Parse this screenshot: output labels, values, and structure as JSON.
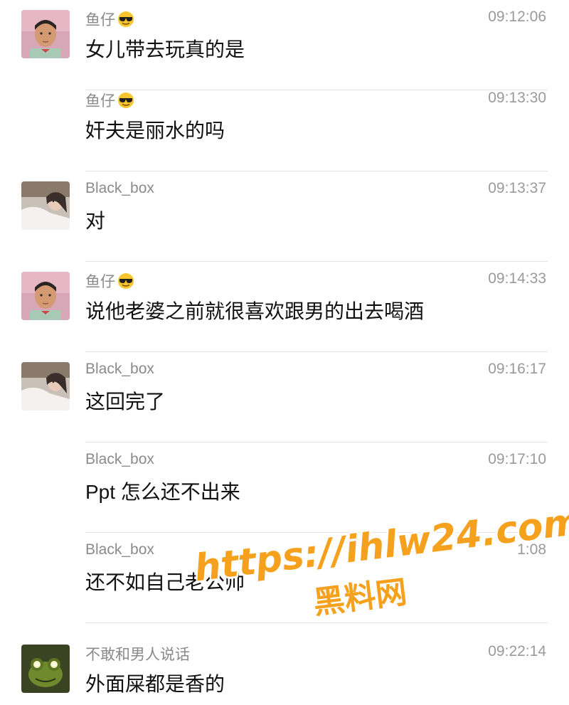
{
  "messages": [
    {
      "sender": "鱼仔",
      "time": "09:12:06",
      "text": "女儿带去玩真的是"
    },
    {
      "sender": "鱼仔",
      "time": "09:13:30",
      "text": "奸夫是丽水的吗"
    },
    {
      "sender": "Black_box",
      "time": "09:13:37",
      "text": "对"
    },
    {
      "sender": "鱼仔",
      "time": "09:14:33",
      "text": "说他老婆之前就很喜欢跟男的出去喝酒"
    },
    {
      "sender": "Black_box",
      "time": "09:16:17",
      "text": "这回完了"
    },
    {
      "sender": "Black_box",
      "time": "09:17:10",
      "text": "Ppt 怎么还不出来"
    },
    {
      "sender": "Black_box",
      "time": "1:08",
      "text": "还不如自己老公帅"
    },
    {
      "sender": "不敢和男人说话",
      "time": "09:22:14",
      "text": "外面屎都是香的"
    }
  ],
  "watermark": {
    "url": "https://ihlw24.com",
    "label": "黑料网"
  },
  "icons": {
    "sender_emoji": "sunglasses-smiley-icon",
    "avatar_yuzai": "boy-portrait-avatar",
    "avatar_blackbox": "girl-portrait-avatar",
    "avatar_frog": "glowing-frog-avatar"
  },
  "colors": {
    "name": "#8a8a8a",
    "time": "#9a9a9a",
    "text": "#111111",
    "divider": "#e3e3e3",
    "watermark": "#f5a11d"
  }
}
